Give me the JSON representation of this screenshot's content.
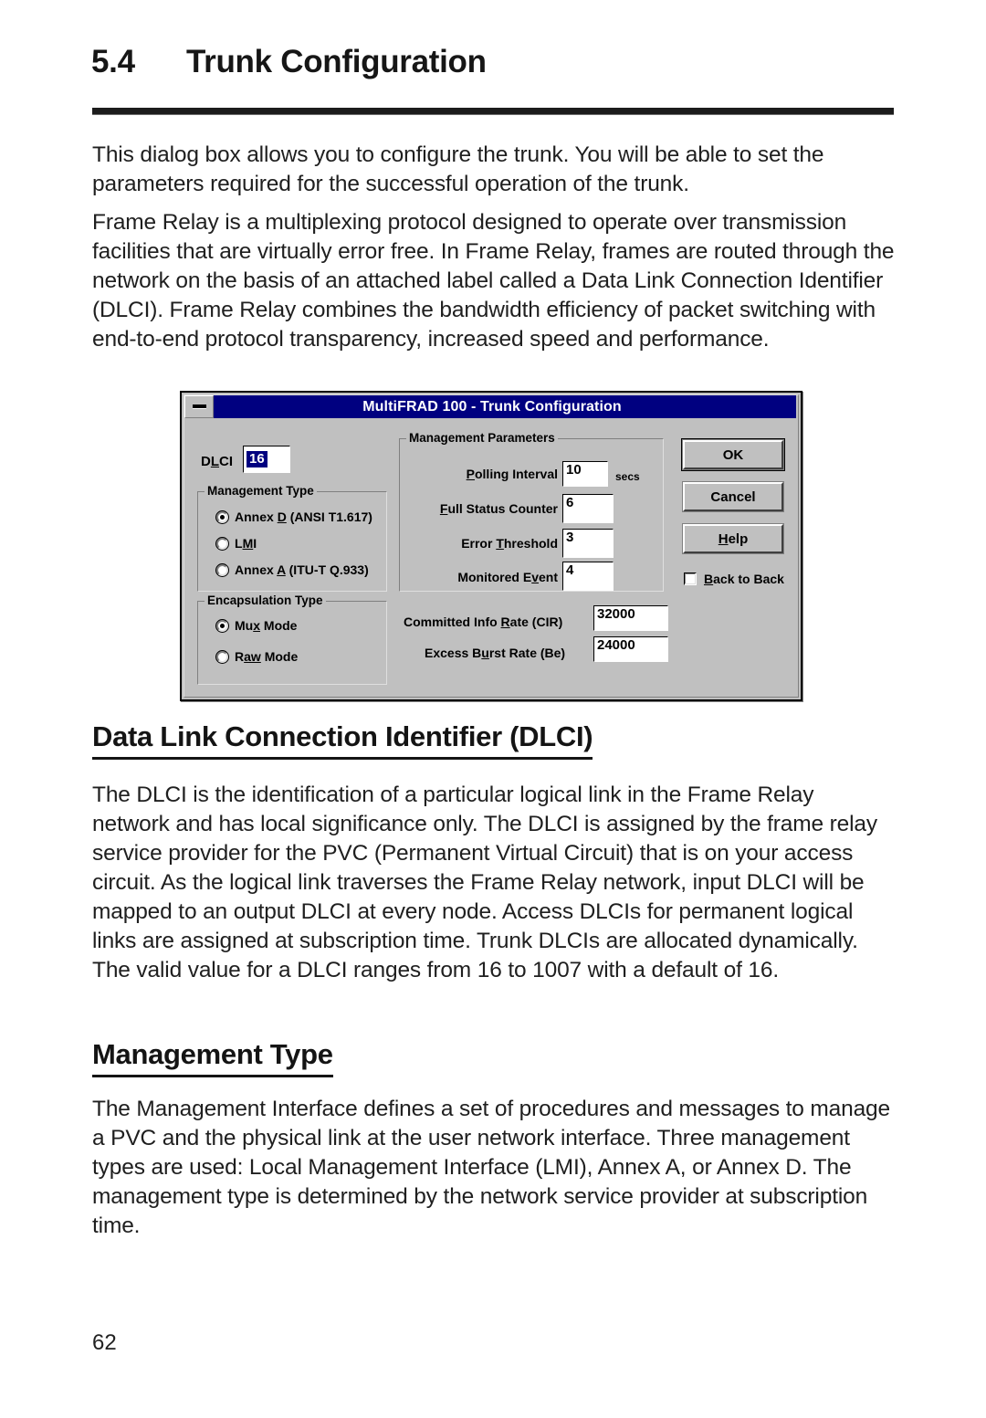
{
  "section": {
    "number": "5.4",
    "title": "Trunk Configuration"
  },
  "paragraphs": {
    "intro": "This dialog box allows you to configure the trunk.  You will be able to set the parameters required for the successful operation of the trunk.",
    "frame_relay": "Frame Relay is a multiplexing protocol designed to operate over transmission facilities that are virtually error free.  In Frame Relay, frames are routed through the network on the basis of an attached label called a Data Link Connection Identifier (DLCI).  Frame Relay combines the bandwidth efficiency of packet switching with end-to-end protocol transparency, increased speed and performance.",
    "dlci": "The DLCI is the identification of a particular logical link in the Frame Relay network and has local significance only. The DLCI is assigned by the frame relay service provider for the PVC (Permanent Virtual Circuit) that is on your access circuit.  As the logical link traverses the Frame Relay network, input DLCI will be mapped to an output DLCI at every node.  Access DLCIs for permanent logical links are assigned at subscription time.  Trunk DLCIs are allocated dynamically.  The valid value for a DLCI ranges from 16 to 1007 with a default of 16.",
    "management_type": "The Management Interface defines a set of procedures and messages to manage a PVC and the physical link at the user network interface.  Three management types are used: Local Management Interface (LMI), Annex A, or Annex D.  The management type is determined by the network service provider at subscription time."
  },
  "headings": {
    "dlci": "Data Link Connection Identifier (DLCI)",
    "management_type": "Management Type"
  },
  "page_number": "62",
  "dialog": {
    "title": "MultiFRAD 100 - Trunk Configuration",
    "titlebar_color": "#000080",
    "face_color": "#c0c0c0",
    "sysmenu_icon": "minimize-box-icon",
    "dlci": {
      "label": "DLCI",
      "value": "16",
      "selected": true
    },
    "management_type": {
      "legend": "Management Type",
      "options": [
        {
          "label": "Annex D (ANSI T1.617)",
          "selected": true
        },
        {
          "label": "LMI",
          "selected": false
        },
        {
          "label": "Annex A (ITU-T Q.933)",
          "selected": false
        }
      ]
    },
    "encapsulation_type": {
      "legend": "Encapsulation Type",
      "options": [
        {
          "label": "Mux Mode",
          "selected": true
        },
        {
          "label": "Raw Mode",
          "selected": false
        }
      ]
    },
    "management_parameters": {
      "legend": "Management Parameters",
      "fields": [
        {
          "label": "Polling Interval",
          "value": "10",
          "units": "secs"
        },
        {
          "label": "Full Status Counter",
          "value": "6",
          "units": ""
        },
        {
          "label": "Error Threshold",
          "value": "3",
          "units": ""
        },
        {
          "label": "Monitored Event",
          "value": "4",
          "units": ""
        }
      ]
    },
    "rates": [
      {
        "label": "Committed Info Rate (CIR)",
        "value": "32000"
      },
      {
        "label": "Excess Burst Rate (Be)",
        "value": "24000"
      }
    ],
    "buttons": [
      {
        "label": "OK",
        "default": true
      },
      {
        "label": "Cancel",
        "default": false
      },
      {
        "label": "Help",
        "default": false
      }
    ],
    "checkbox": {
      "label": "Back to Back",
      "checked": false
    }
  }
}
